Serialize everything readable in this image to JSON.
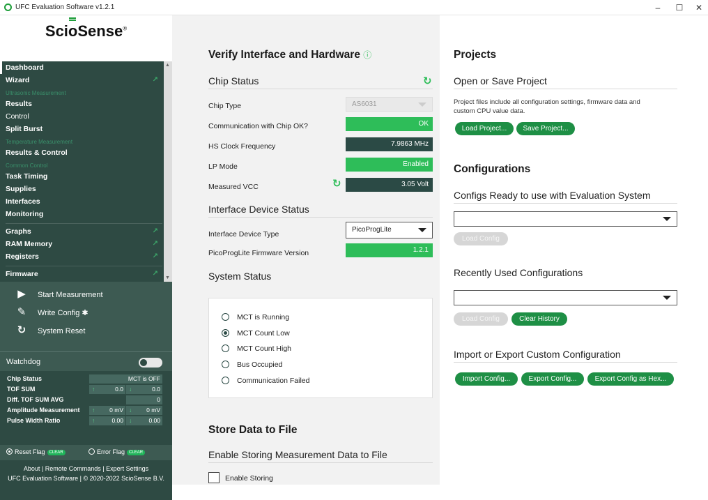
{
  "window": {
    "title": "UFC Evaluation Software v1.2.1",
    "min": "–",
    "max": "☐",
    "close": "✕"
  },
  "logo": {
    "pre": "Sci",
    "o": "o",
    "post": "Sense",
    "mark": "®"
  },
  "nav": {
    "dashboard": "Dashboard",
    "wizard": "Wizard",
    "group_ultrasonic": "Ultrasonic Measurement",
    "results": "Results",
    "control": "Control",
    "split_burst": "Split Burst",
    "group_temperature": "Temperature Measurement",
    "results_control": "Results & Control",
    "group_common": "Common Control",
    "task_timing": "Task Timing",
    "supplies": "Supplies",
    "interfaces": "Interfaces",
    "monitoring": "Monitoring",
    "graphs": "Graphs",
    "ram_memory": "RAM Memory",
    "registers": "Registers",
    "firmware": "Firmware"
  },
  "actions": {
    "start": "Start Measurement",
    "write": "Write Config",
    "write_mark": "✱",
    "reset": "System Reset"
  },
  "watchdog": {
    "label": "Watchdog"
  },
  "measurements": {
    "chip_status_label": "Chip Status",
    "chip_status_value": "MCT is OFF",
    "tof_label": "TOF SUM",
    "tof_up": "0.0",
    "tof_down": "0.0",
    "diff_label": "Diff. TOF SUM AVG",
    "diff_value": "0",
    "amp_label": "Amplitude Measurement",
    "amp_up": "0 mV",
    "amp_down": "0 mV",
    "pwr_label": "Pulse Width Ratio",
    "pwr_up": "0.00",
    "pwr_down": "0.00"
  },
  "flags": {
    "reset": "Reset Flag",
    "error": "Error Flag",
    "clear": "CLEAR"
  },
  "footer": {
    "line1": "About | Remote Commands | Expert Settings",
    "line2": "UFC Evaluation Software | © 2020-2022 ScioSense B.V."
  },
  "verify": {
    "title": "Verify Interface and Hardware",
    "info": "ⓘ"
  },
  "chip": {
    "title": "Chip Status",
    "type_label": "Chip Type",
    "type_value": "AS6031",
    "comm_label": "Communication with Chip OK?",
    "comm_value": "OK",
    "hs_label": "HS Clock Frequency",
    "hs_value": "7.9863 MHz",
    "lp_label": "LP Mode",
    "lp_value": "Enabled",
    "vcc_label": "Measured VCC",
    "vcc_value": "3.05 Volt"
  },
  "iface": {
    "title": "Interface Device Status",
    "type_label": "Interface Device Type",
    "type_value": "PicoProgLite",
    "fw_label": "PicoProgLite Firmware Version",
    "fw_value": "1.2.1"
  },
  "system": {
    "title": "System Status",
    "items": [
      "MCT is Running",
      "MCT Count Low",
      "MCT Count High",
      "Bus Occupied",
      "Communication Failed"
    ]
  },
  "store": {
    "title": "Store Data to File",
    "sub": "Enable Storing Measurement Data to File",
    "check": "Enable Storing"
  },
  "projects": {
    "title": "Projects",
    "sub": "Open or Save Project",
    "desc1": "Project files include all configuration settings, firmware data and",
    "desc2": "custom CPU value data.",
    "load": "Load Project...",
    "save": "Save Project..."
  },
  "configs": {
    "title": "Configurations",
    "ready": "Configs Ready to use with Evaluation System",
    "load_config": "Load Config",
    "recent": "Recently Used Configurations",
    "clear_history": "Clear History",
    "impexp": "Import or Export Custom Configuration",
    "import": "Import Config...",
    "export": "Export Config...",
    "export_hex": "Export Config as Hex..."
  },
  "icons": {
    "refresh": "refresh-icon",
    "play": "play-icon",
    "pen": "pen-icon",
    "reset": "reset-icon",
    "external": "external-link-icon"
  },
  "colors": {
    "sidebar": "#2e4a43",
    "accent": "#2ebd59",
    "button": "#1e8f45"
  }
}
